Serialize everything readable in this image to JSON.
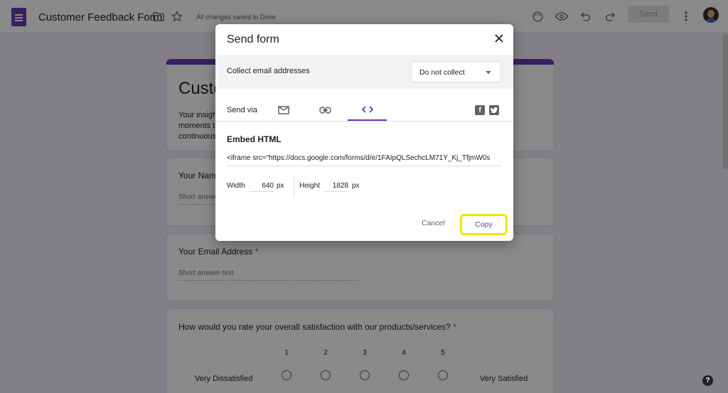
{
  "header": {
    "doc_title": "Customer Feedback Form",
    "save_status": "All changes saved in Drive",
    "send_label": "Send",
    "icons": [
      "folder-icon",
      "star-icon",
      "palette-icon",
      "preview-eye-icon",
      "undo-icon",
      "redo-icon",
      "more-vert-icon"
    ]
  },
  "form": {
    "title": "Customer Feedback Form",
    "description_lines": [
      "Your insights",
      "moments to",
      "continuous"
    ],
    "questions": [
      {
        "label": "Your Name",
        "required": "",
        "placeholder": "Short answer text"
      },
      {
        "label": "Your Email Address",
        "required": "*",
        "placeholder": "Short answer text"
      },
      {
        "label": "How would you rate your overall satisfaction with our products/services?",
        "required": "*"
      }
    ],
    "scale": {
      "numbers": [
        "1",
        "2",
        "3",
        "4",
        "5"
      ],
      "low_label": "Very Dissatisfied",
      "high_label": "Very Satisfied"
    }
  },
  "dialog": {
    "title": "Send form",
    "collect_label": "Collect email addresses",
    "collect_value": "Do not collect",
    "send_via_label": "Send via",
    "active_tab": "embed",
    "embed_title": "Embed HTML",
    "embed_code": "<iframe src=\"https://docs.google.com/forms/d/e/1FAIpQLSechcLM71Y_Kj_TfjmW0s",
    "width_label": "Width",
    "width_value": "640",
    "height_label": "Height",
    "height_value": "1828",
    "unit": "px",
    "cancel_label": "Cancel",
    "copy_label": "Copy"
  },
  "colors": {
    "accent": "#673ab7",
    "highlight": "#f3e600",
    "background": "#f0ebf8"
  }
}
